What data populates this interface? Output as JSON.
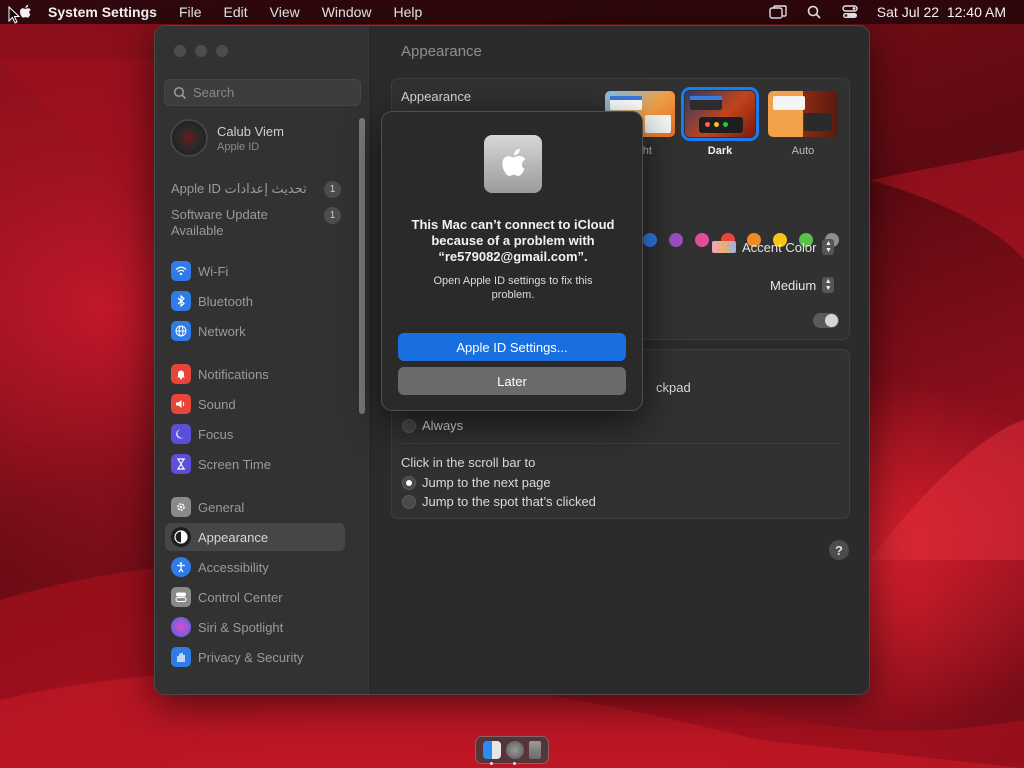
{
  "menubar": {
    "app_name": "System Settings",
    "items": [
      "File",
      "Edit",
      "View",
      "Window",
      "Help"
    ],
    "clock": "Sat Jul 22  12:40 AM"
  },
  "sidebar": {
    "search_placeholder": "Search",
    "account": {
      "name": "Calub Viem",
      "sub": "Apple ID"
    },
    "notices": [
      {
        "label": "Apple ID تحديث إعدادات",
        "badge": "1"
      },
      {
        "label": "Software Update Available",
        "badge": "1"
      }
    ],
    "items": [
      {
        "label": "Wi-Fi",
        "icon": "wifi-icon",
        "color": "#2f7be8"
      },
      {
        "label": "Bluetooth",
        "icon": "bluetooth-icon",
        "color": "#2f7be8"
      },
      {
        "label": "Network",
        "icon": "globe-icon",
        "color": "#2f7be8"
      },
      {
        "label": "Notifications",
        "icon": "bell-icon",
        "color": "#e8443a"
      },
      {
        "label": "Sound",
        "icon": "speaker-icon",
        "color": "#e8443a"
      },
      {
        "label": "Focus",
        "icon": "moon-icon",
        "color": "#5b4fd8"
      },
      {
        "label": "Screen Time",
        "icon": "hourglass-icon",
        "color": "#5b4fd8"
      },
      {
        "label": "General",
        "icon": "gear-icon",
        "color": "#8a8a8a"
      },
      {
        "label": "Appearance",
        "icon": "appearance-icon",
        "color": "#2a2a2a"
      },
      {
        "label": "Accessibility",
        "icon": "accessibility-icon",
        "color": "#2f7be8"
      },
      {
        "label": "Control Center",
        "icon": "control-center-icon",
        "color": "#8a8a8a"
      },
      {
        "label": "Siri & Spotlight",
        "icon": "siri-icon",
        "color": "#a040d0"
      },
      {
        "label": "Privacy & Security",
        "icon": "hand-icon",
        "color": "#2f7be8"
      }
    ]
  },
  "main": {
    "title": "Appearance",
    "appearance_label": "Appearance",
    "themes": [
      {
        "label": "Light"
      },
      {
        "label": "Dark"
      },
      {
        "label": "Auto"
      }
    ],
    "selected_theme": "Dark",
    "accent_colors": [
      "#2f7be8",
      "#9a4fc4",
      "#e24c9c",
      "#e8443a",
      "#f08a24",
      "#f5c518",
      "#5bc04a",
      "#8e8e8e"
    ],
    "accent_color_label": "Accent Color",
    "sidebar_icon_size_value": "Medium",
    "scroll_option_partial": "ckpad",
    "always_label": "Always",
    "click_scroll_label": "Click in the scroll bar to",
    "scroll_options": [
      {
        "label": "Jump to the next page",
        "selected": true
      },
      {
        "label": "Jump to the spot that’s clicked",
        "selected": false
      }
    ],
    "help": "?"
  },
  "dialog": {
    "title": "This Mac can’t connect to iCloud because of a problem with “re579082@gmail.com”.",
    "message": "Open Apple ID settings to fix this problem.",
    "primary_button": "Apple ID Settings...",
    "secondary_button": "Later"
  },
  "colors": {
    "accent": "#1a6fe0",
    "window_bg": "#2b2b2b"
  }
}
